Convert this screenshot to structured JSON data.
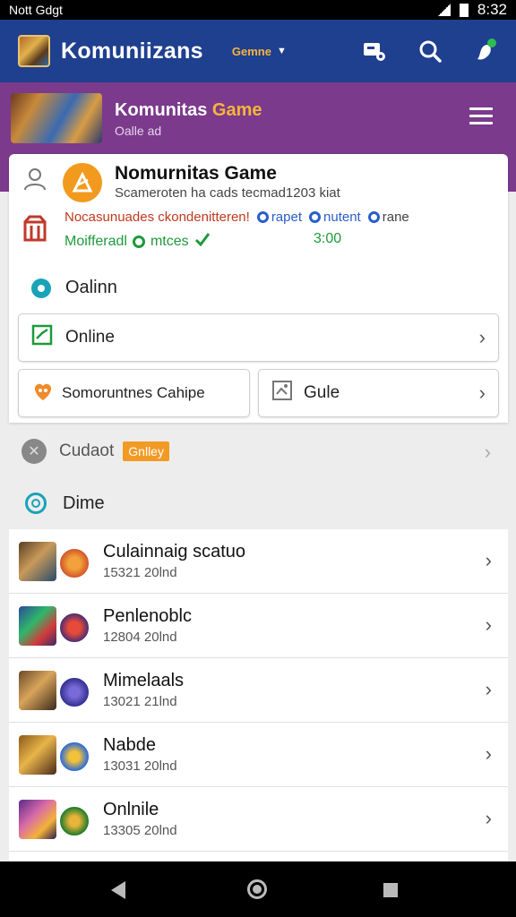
{
  "status_bar": {
    "carrier": "Nott Gdgt",
    "time": "8:32"
  },
  "app_bar": {
    "title": "Komuniizans",
    "dropdown_label": "Gemne",
    "actions": [
      "chat-icon",
      "search-icon",
      "notification-icon"
    ]
  },
  "banner": {
    "title_part1": "Komunitas ",
    "title_part2": "Game",
    "subtitle": "Oalle ad"
  },
  "card": {
    "title": "Nomurnitas Game",
    "subtitle": "Scameroten ha cads tecmad1203 kiat",
    "meta_orange": "Nocasunuades ckondenitteren!",
    "tags": [
      "rapet",
      "nutent",
      "rane"
    ],
    "status_text": "Moifferadl",
    "status_tag": "mtces",
    "time": "3:00"
  },
  "section_online_label": "Oalinn",
  "online_button": "Online",
  "community_button": "Somoruntnes Cahipe",
  "guide_button": "Gule",
  "contact_row": {
    "label": "Cudaot",
    "badge": "Gnlley"
  },
  "dime_label": "Dime",
  "list": [
    {
      "title": "Culainnaig scatuo",
      "sub": "15321 20lnd"
    },
    {
      "title": "Penlenoblc",
      "sub": "12804 20lnd"
    },
    {
      "title": "Mimelaals",
      "sub": "13021 21lnd"
    },
    {
      "title": "Nabde",
      "sub": "13031 20lnd"
    },
    {
      "title": "Onlnile",
      "sub": "13305 20lnd"
    }
  ]
}
